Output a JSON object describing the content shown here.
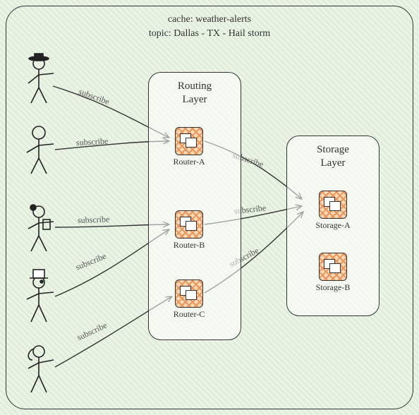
{
  "header": {
    "cache": "cache: weather-alerts",
    "topic": "topic: Dallas - TX - Hail storm"
  },
  "routing": {
    "title_l1": "Routing",
    "title_l2": "Layer",
    "routers": [
      {
        "label": "Router-A"
      },
      {
        "label": "Router-B"
      },
      {
        "label": "Router-C"
      }
    ]
  },
  "storage": {
    "title_l1": "Storage",
    "title_l2": "Layer",
    "nodes": [
      {
        "label": "Storage-A"
      },
      {
        "label": "Storage-B"
      }
    ]
  },
  "edges": {
    "u1": "subscribe",
    "u2": "subscribe",
    "u3": "subscribe",
    "u4": "subscribe",
    "u5": "subscribe",
    "rA": "subscribe",
    "rB": "subscribe",
    "rC": "subscribe"
  },
  "actors": [
    "user-hat",
    "user-plain",
    "user-bun",
    "user-tophat",
    "user-ponytail"
  ]
}
